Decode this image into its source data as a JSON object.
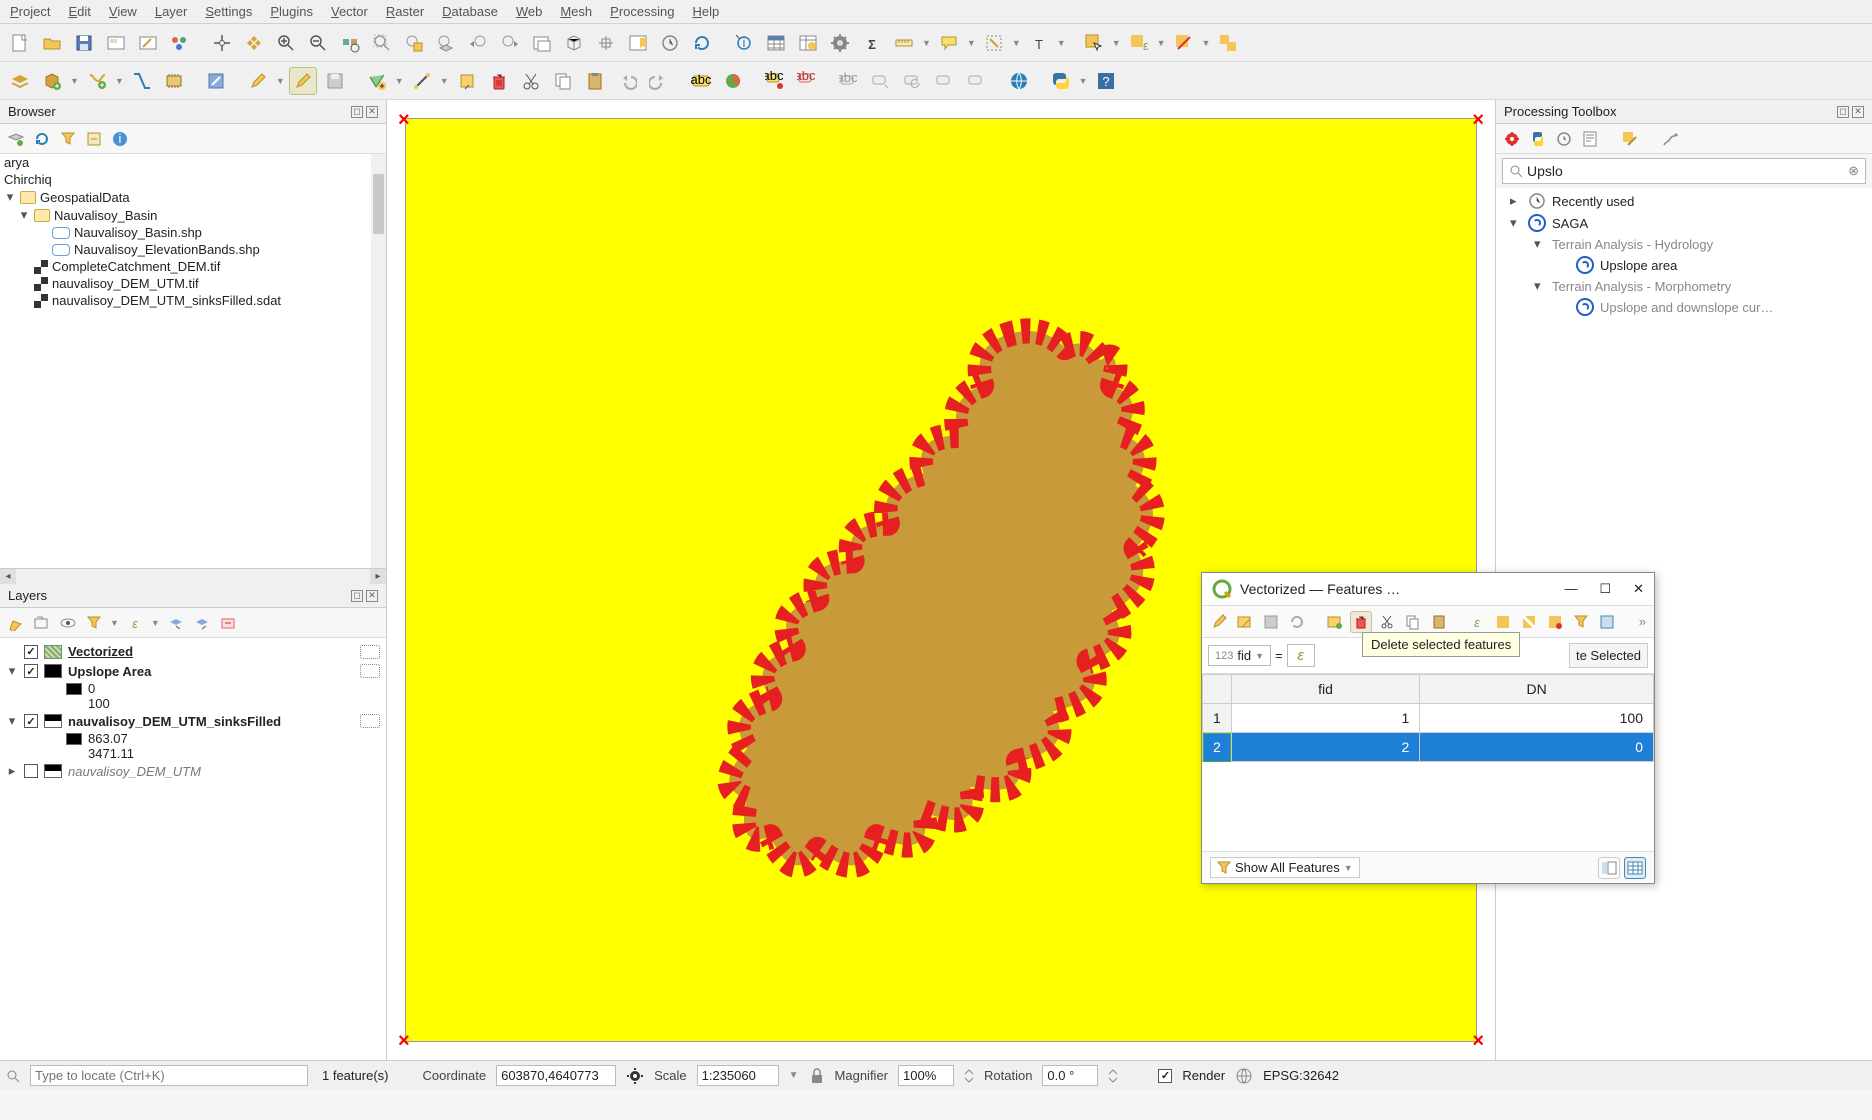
{
  "menu": [
    "Project",
    "Edit",
    "View",
    "Layer",
    "Settings",
    "Plugins",
    "Vector",
    "Raster",
    "Database",
    "Web",
    "Mesh",
    "Processing",
    "Help"
  ],
  "browser": {
    "title": "Browser",
    "items": [
      {
        "label": "arya",
        "type": "plain"
      },
      {
        "label": "Chirchiq",
        "type": "plain"
      },
      {
        "label": "GeospatialData",
        "type": "folder",
        "expander": "▾"
      },
      {
        "label": "Nauvalisoy_Basin",
        "type": "folder",
        "indent": 1,
        "expander": "▾"
      },
      {
        "label": "Nauvalisoy_Basin.shp",
        "type": "shp",
        "indent": 2
      },
      {
        "label": "Nauvalisoy_ElevationBands.shp",
        "type": "shp",
        "indent": 2
      },
      {
        "label": "CompleteCatchment_DEM.tif",
        "type": "rast",
        "indent": 1
      },
      {
        "label": "nauvalisoy_DEM_UTM.tif",
        "type": "rast",
        "indent": 1
      },
      {
        "label": "nauvalisoy_DEM_UTM_sinksFilled.sdat",
        "type": "rast",
        "indent": 1,
        "cut": true
      }
    ]
  },
  "layers": {
    "title": "Layers",
    "items": [
      {
        "name": "Vectorized",
        "checked": true,
        "swatch": "#c9b24a",
        "underline": true,
        "hatched": true
      },
      {
        "name": "Upslope Area",
        "checked": true,
        "swatch": "#000",
        "expander": "▾",
        "children": [
          {
            "swatch": "#000",
            "label": "0"
          },
          {
            "label": "100"
          }
        ]
      },
      {
        "name": "nauvalisoy_DEM_UTM_sinksFilled",
        "checked": true,
        "swatch": "#000",
        "expander": "▾",
        "gradient": true,
        "children": [
          {
            "swatch": "#000",
            "label": "863.07"
          },
          {
            "label": "3471.11"
          }
        ]
      },
      {
        "name": "nauvalisoy_DEM_UTM",
        "checked": false,
        "swatch": "#000",
        "italic": true,
        "gradient": true,
        "expander": "▸"
      }
    ]
  },
  "attr": {
    "title": "Vectorized — Features …",
    "tooltip": "Delete selected features",
    "field_prefix": "123",
    "field": "fid",
    "btn_update": "te Selected",
    "headers": [
      "",
      "fid",
      "DN"
    ],
    "rows": [
      {
        "n": "1",
        "fid": "1",
        "dn": "100",
        "sel": false
      },
      {
        "n": "2",
        "fid": "2",
        "dn": "0",
        "sel": true
      }
    ],
    "footer": "Show All Features"
  },
  "processing": {
    "title": "Processing Toolbox",
    "search": "Upslo",
    "tree": [
      {
        "exp": "▸",
        "icon": "clock",
        "label": "Recently used",
        "i": 1
      },
      {
        "exp": "▾",
        "icon": "saga",
        "label": "SAGA",
        "i": 1
      },
      {
        "exp": "▾",
        "label": "Terrain Analysis - Hydrology",
        "i": 2,
        "grey": true
      },
      {
        "icon": "saga",
        "label": "Upslope area",
        "i": 3
      },
      {
        "exp": "▾",
        "label": "Terrain Analysis - Morphometry",
        "i": 2,
        "grey": true
      },
      {
        "icon": "saga",
        "label": "Upslope and downslope cur…",
        "i": 3,
        "grey": true
      }
    ]
  },
  "status": {
    "locator_placeholder": "Type to locate (Ctrl+K)",
    "features": "1 feature(s)",
    "coord_label": "Coordinate",
    "coord": "603870,4640773",
    "scale_label": "Scale",
    "scale": "1:235060",
    "mag_label": "Magnifier",
    "mag": "100%",
    "rot_label": "Rotation",
    "rot": "0.0 °",
    "render": "Render",
    "crs": "EPSG:32642"
  }
}
